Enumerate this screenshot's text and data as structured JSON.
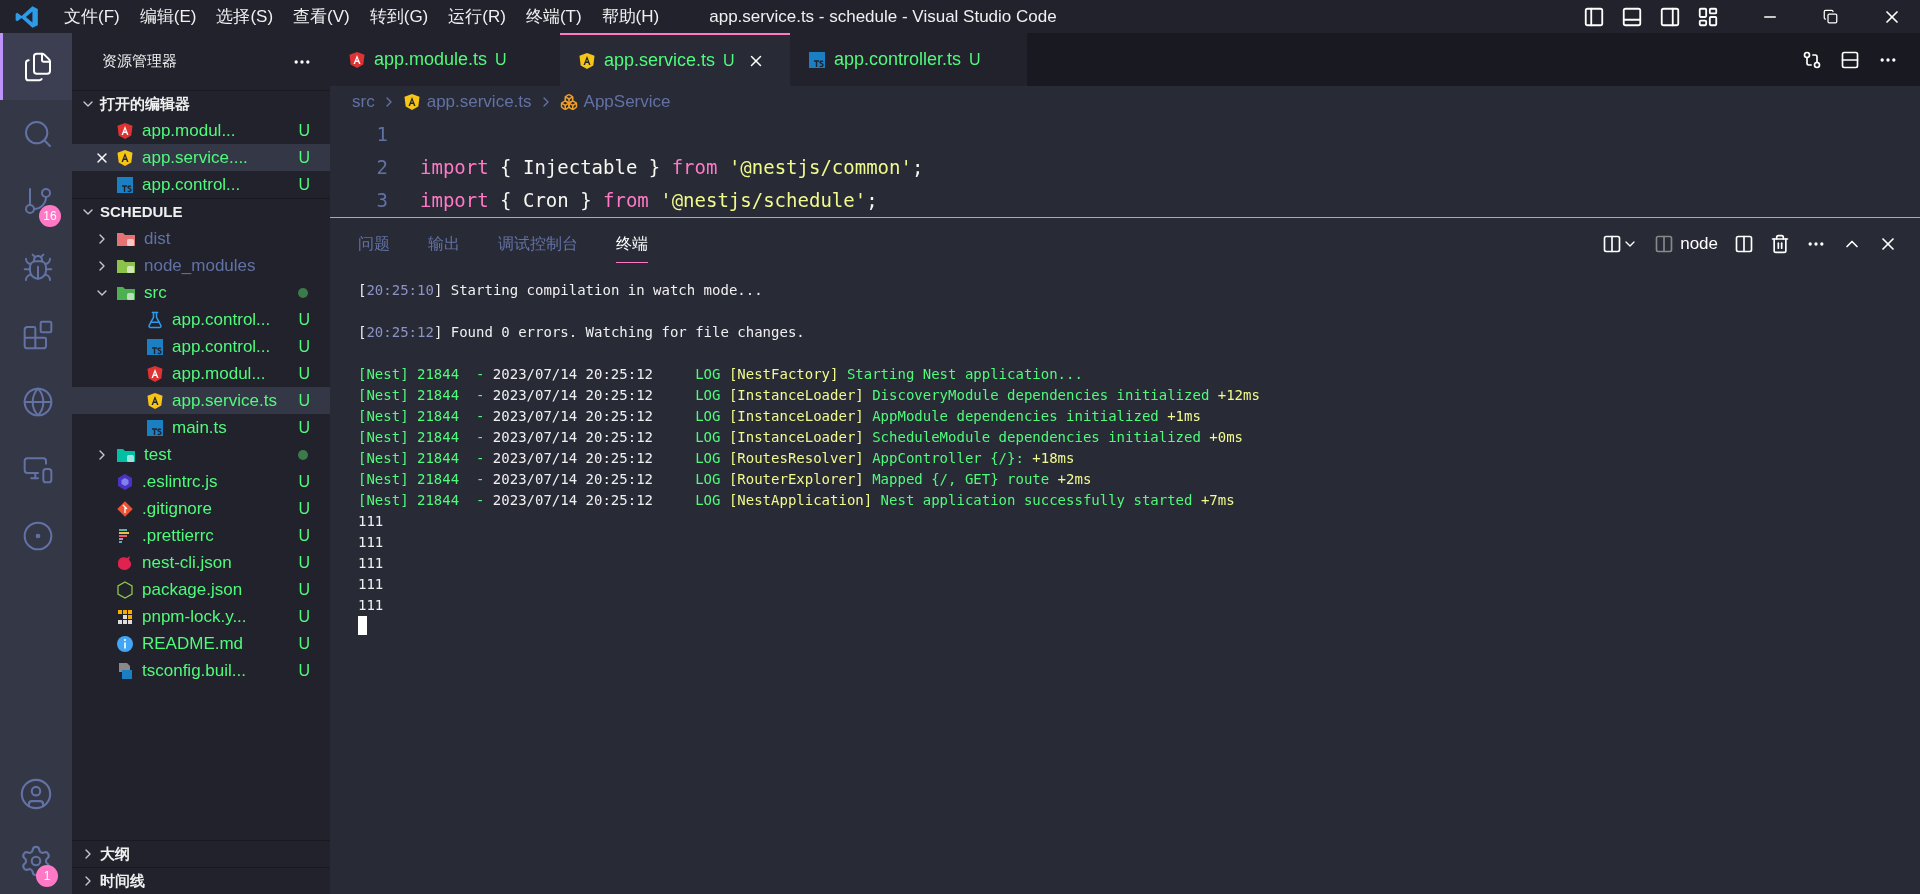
{
  "window": {
    "title": "app.service.ts - schedule - Visual Studio Code"
  },
  "menu": [
    "文件(F)",
    "编辑(E)",
    "选择(S)",
    "查看(V)",
    "转到(G)",
    "运行(R)",
    "终端(T)",
    "帮助(H)"
  ],
  "activity_bar": [
    {
      "kind": "explorer",
      "selected": true
    },
    {
      "kind": "search",
      "selected": false
    },
    {
      "kind": "scm",
      "selected": false,
      "badge": "16"
    },
    {
      "kind": "debug",
      "selected": false
    },
    {
      "kind": "extensions",
      "selected": false
    },
    {
      "kind": "edge",
      "selected": false
    },
    {
      "kind": "remote",
      "selected": false
    },
    {
      "kind": "ring",
      "selected": false
    }
  ],
  "activity_bottom": [
    {
      "kind": "account"
    },
    {
      "kind": "settings",
      "badge": "1"
    }
  ],
  "explorer": {
    "title": "资源管理器",
    "open_editors": {
      "title": "打开的编辑器",
      "expanded": true,
      "items": [
        {
          "kind": "angular-red",
          "name": "app.modul...",
          "status": "U",
          "selected": false
        },
        {
          "kind": "angular-yellow",
          "name": "app.service....",
          "status": "U",
          "selected": true,
          "closable": true
        },
        {
          "kind": "ts",
          "name": "app.control...",
          "status": "U",
          "selected": false
        }
      ]
    },
    "project": {
      "title": "SCHEDULE",
      "expanded": true,
      "items": [
        {
          "kind": "folder-dist",
          "name": "dist",
          "expanded": false,
          "ignored": true,
          "selected": false
        },
        {
          "kind": "folder-node",
          "name": "node_modules",
          "expanded": false,
          "ignored": true,
          "selected": false
        },
        {
          "kind": "folder-src",
          "name": "src",
          "expanded": true,
          "ignored": false,
          "dot": true,
          "selected": false,
          "children": [
            {
              "kind": "flask",
              "name": "app.control...",
              "status": "U",
              "selected": false
            },
            {
              "kind": "ts",
              "name": "app.control...",
              "status": "U",
              "selected": false
            },
            {
              "kind": "angular-red",
              "name": "app.modul...",
              "status": "U",
              "selected": false
            },
            {
              "kind": "angular-yellow",
              "name": "app.service.ts",
              "status": "U",
              "selected": true
            },
            {
              "kind": "ts",
              "name": "main.ts",
              "status": "U",
              "selected": false
            }
          ]
        },
        {
          "kind": "folder-test",
          "name": "test",
          "expanded": false,
          "ignored": false,
          "dot": true,
          "selected": false
        },
        {
          "kind": "eslint",
          "name": ".eslintrc.js",
          "status": "U",
          "selected": false
        },
        {
          "kind": "git",
          "name": ".gitignore",
          "status": "U",
          "selected": false
        },
        {
          "kind": "prettier",
          "name": ".prettierrc",
          "status": "U",
          "selected": false
        },
        {
          "kind": "nest",
          "name": "nest-cli.json",
          "status": "U",
          "selected": false
        },
        {
          "kind": "js",
          "name": "package.json",
          "status": "U",
          "selected": false
        },
        {
          "kind": "pnpm",
          "name": "pnpm-lock.y...",
          "status": "U",
          "selected": false
        },
        {
          "kind": "info",
          "name": "README.md",
          "status": "U",
          "selected": false
        },
        {
          "kind": "tsconfig",
          "name": "tsconfig.buil...",
          "status": "U",
          "selected": false
        }
      ]
    },
    "sections": [
      {
        "title": "大纲",
        "expanded": false
      },
      {
        "title": "时间线",
        "expanded": false
      }
    ]
  },
  "tabs": [
    {
      "kind": "angular-red",
      "label": "app.module.ts",
      "status": "U",
      "selected": false
    },
    {
      "kind": "angular-yellow",
      "label": "app.service.ts",
      "status": "U",
      "selected": true
    },
    {
      "kind": "ts",
      "label": "app.controller.ts",
      "status": "U",
      "selected": false
    }
  ],
  "breadcrumb": [
    {
      "text": "src"
    },
    {
      "kind": "angular-yellow",
      "text": "app.service.ts"
    },
    {
      "kind": "class",
      "text": "AppService"
    }
  ],
  "code_lines": [
    {
      "number": "1"
    },
    {
      "number": "2",
      "tokens": [
        {
          "kind": "keyword",
          "text": "import"
        },
        {
          "kind": "plain",
          "text": " { Injectable } "
        },
        {
          "kind": "keyword",
          "text": "from"
        },
        {
          "kind": "string",
          "text": "'@nestjs/common'"
        },
        {
          "kind": "plain",
          "text": ";"
        }
      ]
    },
    {
      "number": "3",
      "tokens": [
        {
          "kind": "keyword",
          "text": "import"
        },
        {
          "kind": "plain",
          "text": " { Cron } "
        },
        {
          "kind": "keyword",
          "text": "from"
        },
        {
          "kind": "string",
          "text": "'@nestjs/schedule'"
        },
        {
          "kind": "plain",
          "text": ";"
        }
      ]
    }
  ],
  "panel": {
    "tabs": [
      {
        "label": "问题",
        "selected": false
      },
      {
        "label": "输出",
        "selected": false
      },
      {
        "label": "调试控制台",
        "selected": false
      },
      {
        "label": "终端",
        "selected": true
      }
    ],
    "terminal_name": "node",
    "lines": [
      {
        "kind": "text",
        "segments": [
          {
            "kind": "white",
            "text": "["
          },
          {
            "kind": "dim",
            "text": "20:25:10"
          },
          {
            "kind": "white",
            "text": "] Starting compilation in watch mode..."
          }
        ]
      },
      {
        "kind": "blank"
      },
      {
        "kind": "text",
        "segments": [
          {
            "kind": "white",
            "text": "["
          },
          {
            "kind": "dim",
            "text": "20:25:12"
          },
          {
            "kind": "white",
            "text": "] Found 0 errors. Watching for file changes."
          }
        ]
      },
      {
        "kind": "blank"
      },
      {
        "kind": "text",
        "segments": [
          {
            "kind": "green",
            "text": "[Nest] 21844  - "
          },
          {
            "kind": "white",
            "text": "2023/07/14 20:25:12"
          },
          {
            "kind": "green",
            "text": "     LOG "
          },
          {
            "kind": "yellow",
            "text": "[NestFactory]"
          },
          {
            "kind": "green",
            "text": " Starting Nest application..."
          }
        ]
      },
      {
        "kind": "text",
        "segments": [
          {
            "kind": "green",
            "text": "[Nest] 21844  - "
          },
          {
            "kind": "white",
            "text": "2023/07/14 20:25:12"
          },
          {
            "kind": "green",
            "text": "     LOG "
          },
          {
            "kind": "yellow",
            "text": "[InstanceLoader]"
          },
          {
            "kind": "green",
            "text": " DiscoveryModule dependencies initialized "
          },
          {
            "kind": "yellow",
            "text": "+12ms"
          }
        ]
      },
      {
        "kind": "text",
        "segments": [
          {
            "kind": "green",
            "text": "[Nest] 21844  - "
          },
          {
            "kind": "white",
            "text": "2023/07/14 20:25:12"
          },
          {
            "kind": "green",
            "text": "     LOG "
          },
          {
            "kind": "yellow",
            "text": "[InstanceLoader]"
          },
          {
            "kind": "green",
            "text": " AppModule dependencies initialized "
          },
          {
            "kind": "yellow",
            "text": "+1ms"
          }
        ]
      },
      {
        "kind": "text",
        "segments": [
          {
            "kind": "green",
            "text": "[Nest] 21844  - "
          },
          {
            "kind": "white",
            "text": "2023/07/14 20:25:12"
          },
          {
            "kind": "green",
            "text": "     LOG "
          },
          {
            "kind": "yellow",
            "text": "[InstanceLoader]"
          },
          {
            "kind": "green",
            "text": " ScheduleModule dependencies initialized "
          },
          {
            "kind": "yellow",
            "text": "+0ms"
          }
        ]
      },
      {
        "kind": "text",
        "segments": [
          {
            "kind": "green",
            "text": "[Nest] 21844  - "
          },
          {
            "kind": "white",
            "text": "2023/07/14 20:25:12"
          },
          {
            "kind": "green",
            "text": "     LOG "
          },
          {
            "kind": "yellow",
            "text": "[RoutesResolver]"
          },
          {
            "kind": "green",
            "text": " AppController {/}: "
          },
          {
            "kind": "yellow",
            "text": "+18ms"
          }
        ]
      },
      {
        "kind": "text",
        "segments": [
          {
            "kind": "green",
            "text": "[Nest] 21844  - "
          },
          {
            "kind": "white",
            "text": "2023/07/14 20:25:12"
          },
          {
            "kind": "green",
            "text": "     LOG "
          },
          {
            "kind": "yellow",
            "text": "[RouterExplorer]"
          },
          {
            "kind": "green",
            "text": " Mapped {/, GET} route "
          },
          {
            "kind": "yellow",
            "text": "+2ms"
          }
        ]
      },
      {
        "kind": "text",
        "segments": [
          {
            "kind": "green",
            "text": "[Nest] 21844  - "
          },
          {
            "kind": "white",
            "text": "2023/07/14 20:25:12"
          },
          {
            "kind": "green",
            "text": "     LOG "
          },
          {
            "kind": "yellow",
            "text": "[NestApplication]"
          },
          {
            "kind": "green",
            "text": " Nest application successfully started "
          },
          {
            "kind": "yellow",
            "text": "+7ms"
          }
        ]
      },
      {
        "kind": "text",
        "segments": [
          {
            "kind": "white",
            "text": "111"
          }
        ]
      },
      {
        "kind": "text",
        "segments": [
          {
            "kind": "white",
            "text": "111"
          }
        ]
      },
      {
        "kind": "text",
        "segments": [
          {
            "kind": "white",
            "text": "111"
          }
        ]
      },
      {
        "kind": "text",
        "segments": [
          {
            "kind": "white",
            "text": "111"
          }
        ]
      },
      {
        "kind": "text",
        "segments": [
          {
            "kind": "white",
            "text": "111"
          }
        ]
      }
    ]
  }
}
